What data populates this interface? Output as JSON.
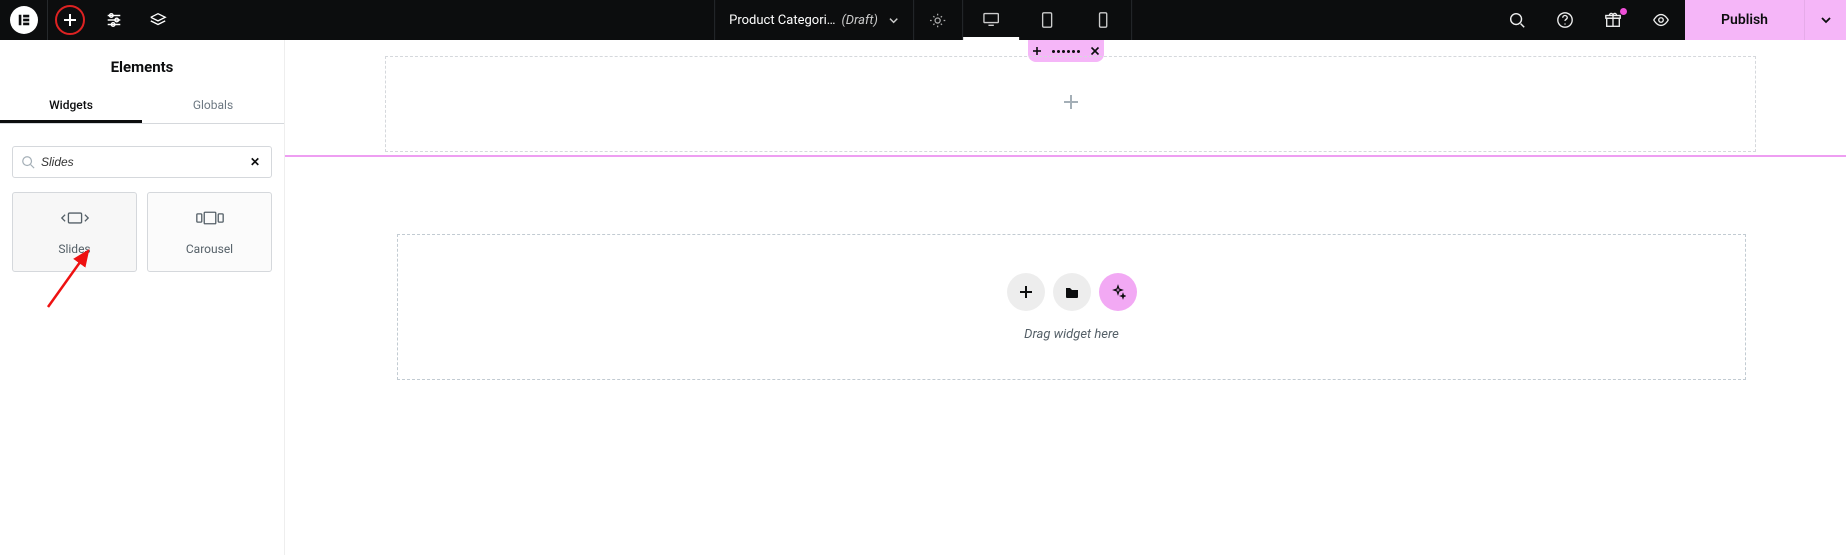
{
  "topbar": {
    "doc_title": "Product Categori…",
    "doc_status": "(Draft)",
    "publish_label": "Publish"
  },
  "sidebar": {
    "panel_title": "Elements",
    "tabs": {
      "widgets": "Widgets",
      "globals": "Globals"
    },
    "search_value": "Slides",
    "widgets": [
      {
        "name": "Slides"
      },
      {
        "name": "Carousel"
      }
    ]
  },
  "canvas": {
    "dropzone_text": "Drag widget here"
  }
}
